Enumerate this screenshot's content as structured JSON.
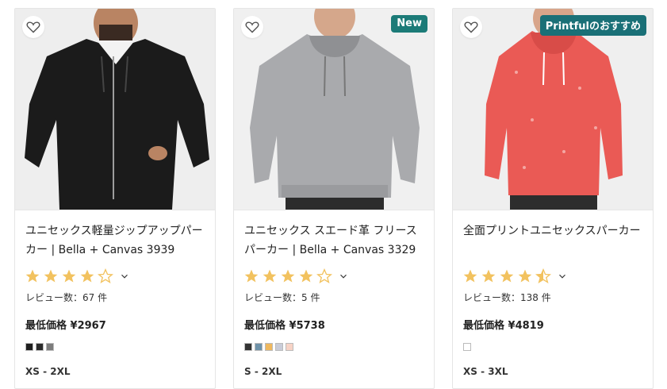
{
  "products": [
    {
      "title": "ユニセックス軽量ジップアップパーカー | Bella + Canvas 3939",
      "badge": "",
      "rating": 4,
      "reviews": "レビュー数：67 件",
      "price": "最低価格 ¥2967",
      "swatches": [
        "#1f1f1f",
        "#2b2b2b",
        "#7d7d7d"
      ],
      "sizes": "XS - 2XL",
      "image_icon": "black-zip-hoodie-photo"
    },
    {
      "title": "ユニセックス スエード革 フリースパーカー | Bella + Canvas 3329",
      "badge": "New",
      "rating": 4,
      "reviews": "レビュー数：5 件",
      "price": "最低価格 ¥5738",
      "swatches": [
        "#343434",
        "#6f93aa",
        "#efb85e",
        "#c9ccd8",
        "#f7d3c6"
      ],
      "sizes": "S - 2XL",
      "image_icon": "grey-hoodie-photo"
    },
    {
      "title": "全面プリントユニセックスパーカー",
      "badge": "Printfulのおすすめ",
      "rating": 4.5,
      "reviews": "レビュー数：138 件",
      "price": "最低価格 ¥4819",
      "swatches": [
        "#ffffff"
      ],
      "sizes": "XS - 3XL",
      "image_icon": "red-print-hoodie-photo"
    }
  ],
  "colors": {
    "star": "#f2c25f",
    "star_empty": "#ffffff",
    "badge_new": "#1c7b78",
    "badge_recommend": "#1a7077"
  }
}
